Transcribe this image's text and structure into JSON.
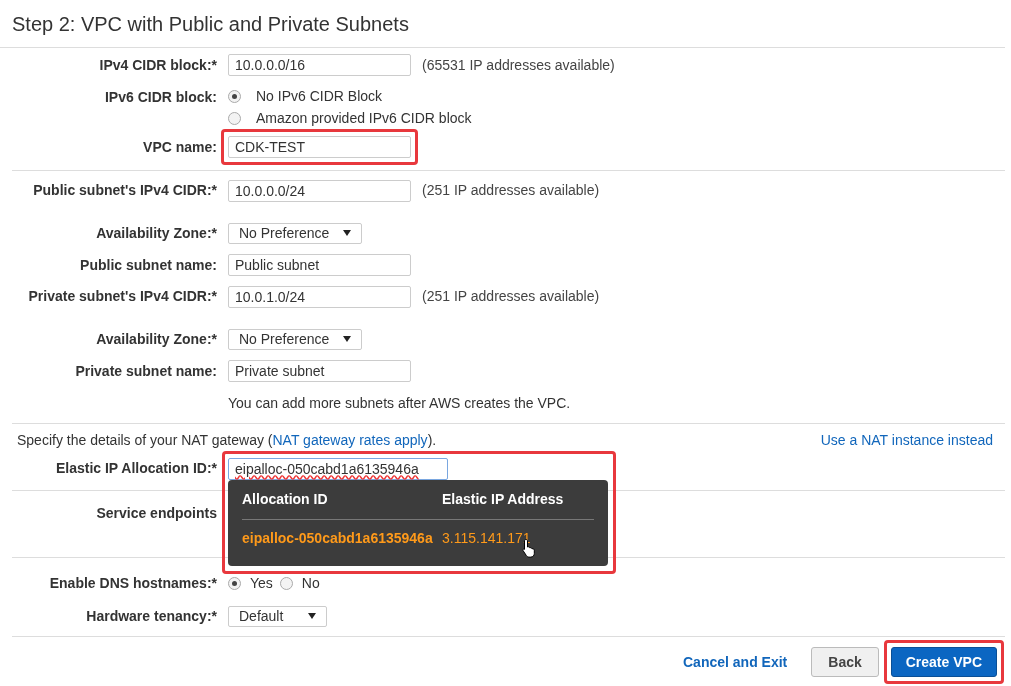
{
  "title": "Step 2: VPC with Public and Private Subnets",
  "sections": [
    {
      "rows": [
        {
          "kind": "text",
          "label": "IPv4 CIDR block:*",
          "value": "10.0.0.0/16",
          "note": "(65531 IP addresses available)",
          "highlighted": false
        },
        {
          "kind": "radio",
          "label": "IPv6 CIDR block:",
          "options": [
            {
              "label": "No IPv6 CIDR Block",
              "selected": true
            },
            {
              "label": "Amazon provided IPv6 CIDR block",
              "selected": false
            }
          ]
        },
        {
          "kind": "text",
          "label": "VPC name:",
          "value": "CDK-TEST",
          "highlighted": true
        }
      ]
    },
    {
      "rows": [
        {
          "kind": "text",
          "label": "Public subnet's IPv4 CIDR:*",
          "value": "10.0.0.0/24",
          "note": "(251 IP addresses available)",
          "highlighted": false
        },
        {
          "kind": "select",
          "label": "Availability Zone:*",
          "value": "No Preference"
        },
        {
          "kind": "text",
          "label": "Public subnet name:",
          "value": "Public subnet",
          "highlighted": false
        },
        {
          "kind": "text",
          "label": "Private subnet's IPv4 CIDR:*",
          "value": "10.0.1.0/24",
          "note": "(251 IP addresses available)",
          "highlighted": false
        },
        {
          "kind": "select",
          "label": "Availability Zone:*",
          "value": "No Preference"
        },
        {
          "kind": "text",
          "label": "Private subnet name:",
          "value": "Private subnet",
          "highlighted": false
        },
        {
          "kind": "hint",
          "text": "You can add more subnets after AWS creates the VPC."
        }
      ]
    },
    {
      "rows": [
        {
          "kind": "intro",
          "before": "Specify the details of your NAT gateway (",
          "link": "NAT gateway rates apply",
          "after": ").",
          "side_link": "Use a NAT instance instead"
        },
        {
          "kind": "elastic",
          "label": "Elastic IP Allocation ID:*",
          "value": "eipalloc-050cabd1a6135946a",
          "highlighted": true,
          "popup": {
            "columns": [
              "Allocation ID",
              "Elastic IP Address"
            ],
            "rows": [
              [
                "eipalloc-050cabd1a6135946a",
                "3.115.141.171"
              ]
            ]
          }
        }
      ]
    },
    {
      "rows": [
        {
          "kind": "label_only",
          "label": "Service endpoints"
        }
      ]
    },
    {
      "rows": [
        {
          "kind": "inline_radio",
          "label": "Enable DNS hostnames:*",
          "options": [
            {
              "label": "Yes",
              "selected": true
            },
            {
              "label": "No",
              "selected": false
            }
          ]
        },
        {
          "kind": "select_small",
          "label": "Hardware tenancy:*",
          "value": "Default"
        }
      ]
    }
  ],
  "footer": {
    "cancel": "Cancel and Exit",
    "back": "Back",
    "create": {
      "label": "Create VPC",
      "highlighted": true
    }
  }
}
